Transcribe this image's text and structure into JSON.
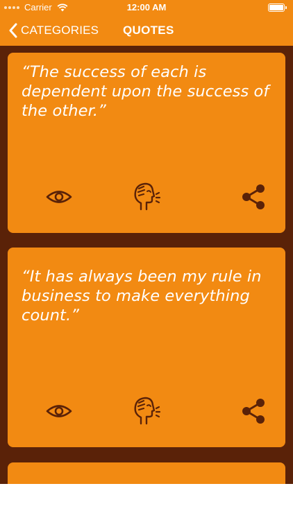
{
  "status_bar": {
    "carrier": "Carrier",
    "time": "12:00 AM"
  },
  "nav": {
    "back_label": "CATEGORIES",
    "title": "QUOTES"
  },
  "quotes": [
    {
      "text": "“The success of each is dependent upon the success of the other.”"
    },
    {
      "text": "“It has always been my rule in business to make everything count.”"
    }
  ],
  "colors": {
    "accent": "#f28a12",
    "background": "#5a2208",
    "icon": "#5a2208",
    "text": "#ffffff"
  },
  "icons": {
    "view": "eye-icon",
    "speak": "speaking-head-icon",
    "share": "share-icon",
    "back": "chevron-left-icon"
  }
}
